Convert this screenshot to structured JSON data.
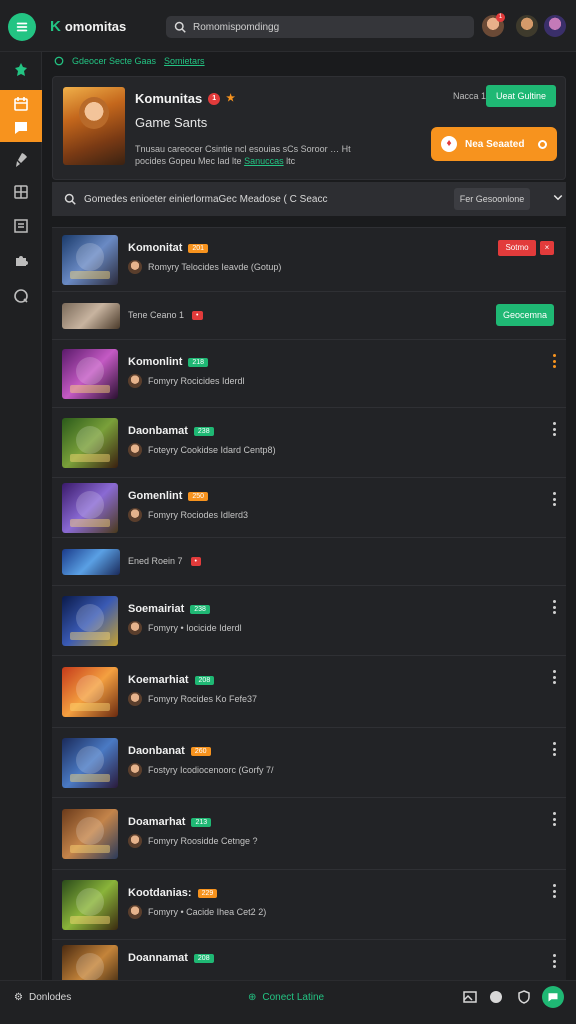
{
  "app": {
    "brand": "omomitas",
    "search_placeholder": "Romomispomdingg",
    "notif_count": "1"
  },
  "colors": {
    "accent_green": "#1fb874",
    "accent_orange": "#f7931e",
    "accent_red": "#e23b3b",
    "bg": "#1a1b1d"
  },
  "breadcrumb": {
    "item1": "Gdeocer Secte Gaas",
    "item2": "Somietars"
  },
  "hero": {
    "title": "Komunitas",
    "badge": "1",
    "subtitle": "Game Sants",
    "desc_line1": "Tnusau careocer Csintie ncl esouias sCs Soroor … Ht",
    "desc_line2": "pocides Gopeu Mec lad lte",
    "desc_link": "Sanuccas",
    "desc_tail": "ltc",
    "count": "Nacca 1",
    "online_button": "Ueat Gultine",
    "primary_button": "Nea Seaated"
  },
  "filter": {
    "text": "Gomedes enioeter einierlormaGec Meadose ( C Seacc",
    "select": "Fer Gesoonlone"
  },
  "rows": [
    {
      "kind": "full",
      "title": "Komonitat",
      "tag": "201",
      "tag_color": "orange",
      "sub": "Romyry  Telocides Ieavde (Gotup)",
      "action": "Sotmo",
      "action_small": "×"
    },
    {
      "kind": "short",
      "label": "Tene Ceano 1",
      "tag": "•",
      "action": "Geocemna"
    },
    {
      "kind": "full",
      "title": "Komonlint",
      "tag": "218",
      "tag_color": "green",
      "sub": "Fomyry  Rocicides Iderdl",
      "kebab": "orange"
    },
    {
      "kind": "full",
      "title": "Daonbamat",
      "tag": "238",
      "tag_color": "green",
      "sub": "Foteyry  Cookidse Idard Centp8)"
    },
    {
      "kind": "full",
      "title": "Gomenlint",
      "tag": "250",
      "tag_color": "orange",
      "sub": "Fomyry  Rociodes Idlerd3"
    },
    {
      "kind": "short",
      "label": "Ened Roein 7",
      "tag": "•"
    },
    {
      "kind": "full",
      "title": "Soemairiat",
      "tag": "238",
      "tag_color": "green",
      "sub": "Fomyry  •  Iocicide Iderdl"
    },
    {
      "kind": "full",
      "title": "Koemarhiat",
      "tag": "208",
      "tag_color": "green",
      "sub": "Fomyry  Rocides Ko Fefe37"
    },
    {
      "kind": "full",
      "title": "Daonbanat",
      "tag": "260",
      "tag_color": "orange",
      "sub": "Fostyry  Icodiocenoorc (Gorfy 7/"
    },
    {
      "kind": "full",
      "title": "Doamarhat",
      "tag": "213",
      "tag_color": "green",
      "sub": "Fomyry  Roosidde Cetnge ?"
    },
    {
      "kind": "full",
      "title": "Kootdanias:",
      "tag": "229",
      "tag_color": "orange",
      "sub": "Fomyry  • Cacide Ihea Cet2 2)"
    },
    {
      "kind": "full",
      "title": "Doannamat",
      "tag": "208",
      "tag_color": "green",
      "sub": ""
    }
  ],
  "bottom": {
    "left": "Donlodes",
    "middle": "Conect Latine"
  },
  "icons": {
    "menu": "menu-icon",
    "search": "search-icon",
    "home": "leaf-icon",
    "calendar": "calendar-icon",
    "chat": "chat-icon",
    "rocket": "rocket-icon",
    "grid": "grid-icon",
    "doc": "doc-icon",
    "puzzle": "puzzle-icon",
    "help": "help-icon"
  }
}
